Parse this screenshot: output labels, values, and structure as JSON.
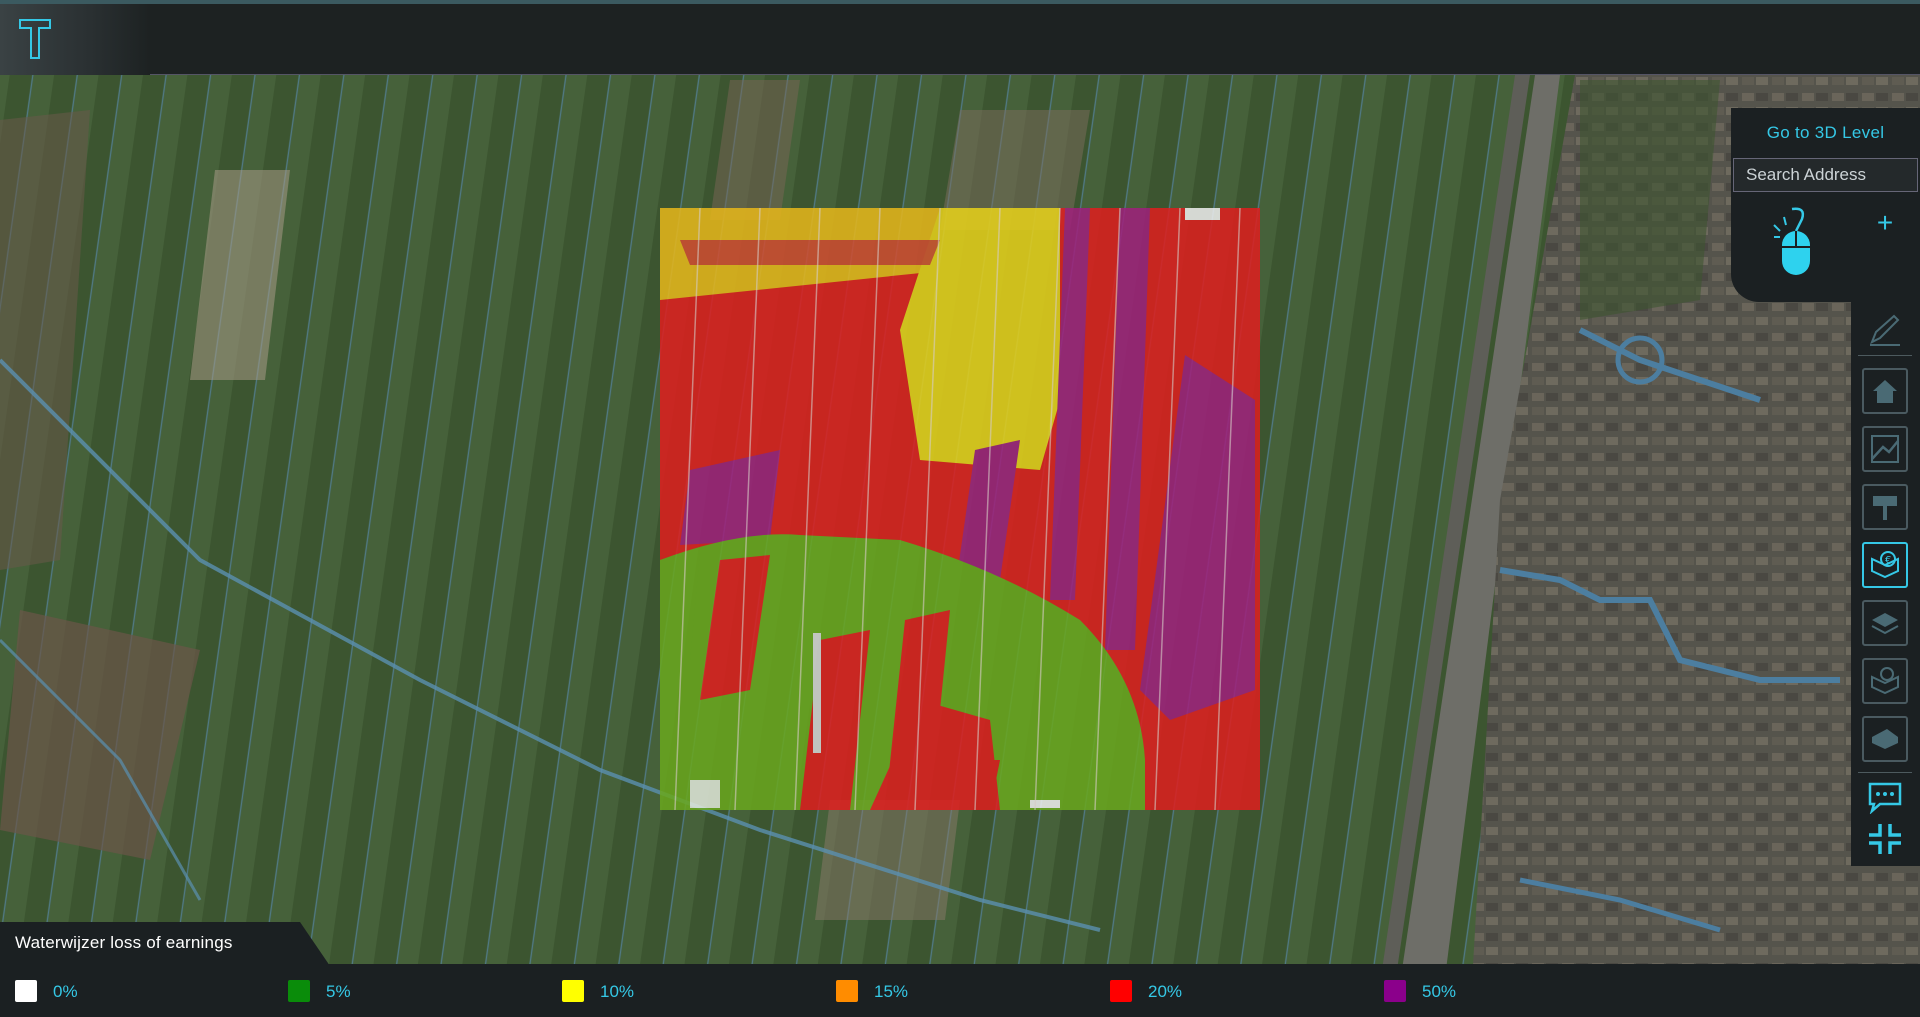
{
  "app": {
    "logo_alt": "T"
  },
  "panel": {
    "goto_3d_label": "Go to 3D Level",
    "search_placeholder": "Search Address",
    "plus_label": "+"
  },
  "toolbar": {
    "items": [
      {
        "name": "pencil-icon",
        "active": false
      },
      {
        "name": "home-icon",
        "active": false
      },
      {
        "name": "terrain-icon",
        "active": false
      },
      {
        "name": "sign-icon",
        "active": false
      },
      {
        "name": "overlay-money-icon",
        "active": true
      },
      {
        "name": "layers-icon",
        "active": false
      },
      {
        "name": "finance-layer-icon",
        "active": false
      },
      {
        "name": "ground-icon",
        "active": false
      },
      {
        "name": "chat-icon",
        "active": false
      },
      {
        "name": "collapse-icon",
        "active": false
      }
    ]
  },
  "legend": {
    "title": "Waterwijzer loss of earnings",
    "items": [
      {
        "label": "0%",
        "color": "#ffffff"
      },
      {
        "label": "5%",
        "color": "#0a8c0a"
      },
      {
        "label": "10%",
        "color": "#ffff00"
      },
      {
        "label": "15%",
        "color": "#ff8c00"
      },
      {
        "label": "20%",
        "color": "#ff0000"
      },
      {
        "label": "50%",
        "color": "#8b008b"
      }
    ]
  },
  "colors": {
    "accent": "#35c8e6",
    "panel_bg": "#1b2022",
    "overlay_red": "#e01e1e",
    "overlay_green": "#6aa81e",
    "overlay_yellow": "#e8d21a",
    "overlay_purple": "#a0207c"
  }
}
